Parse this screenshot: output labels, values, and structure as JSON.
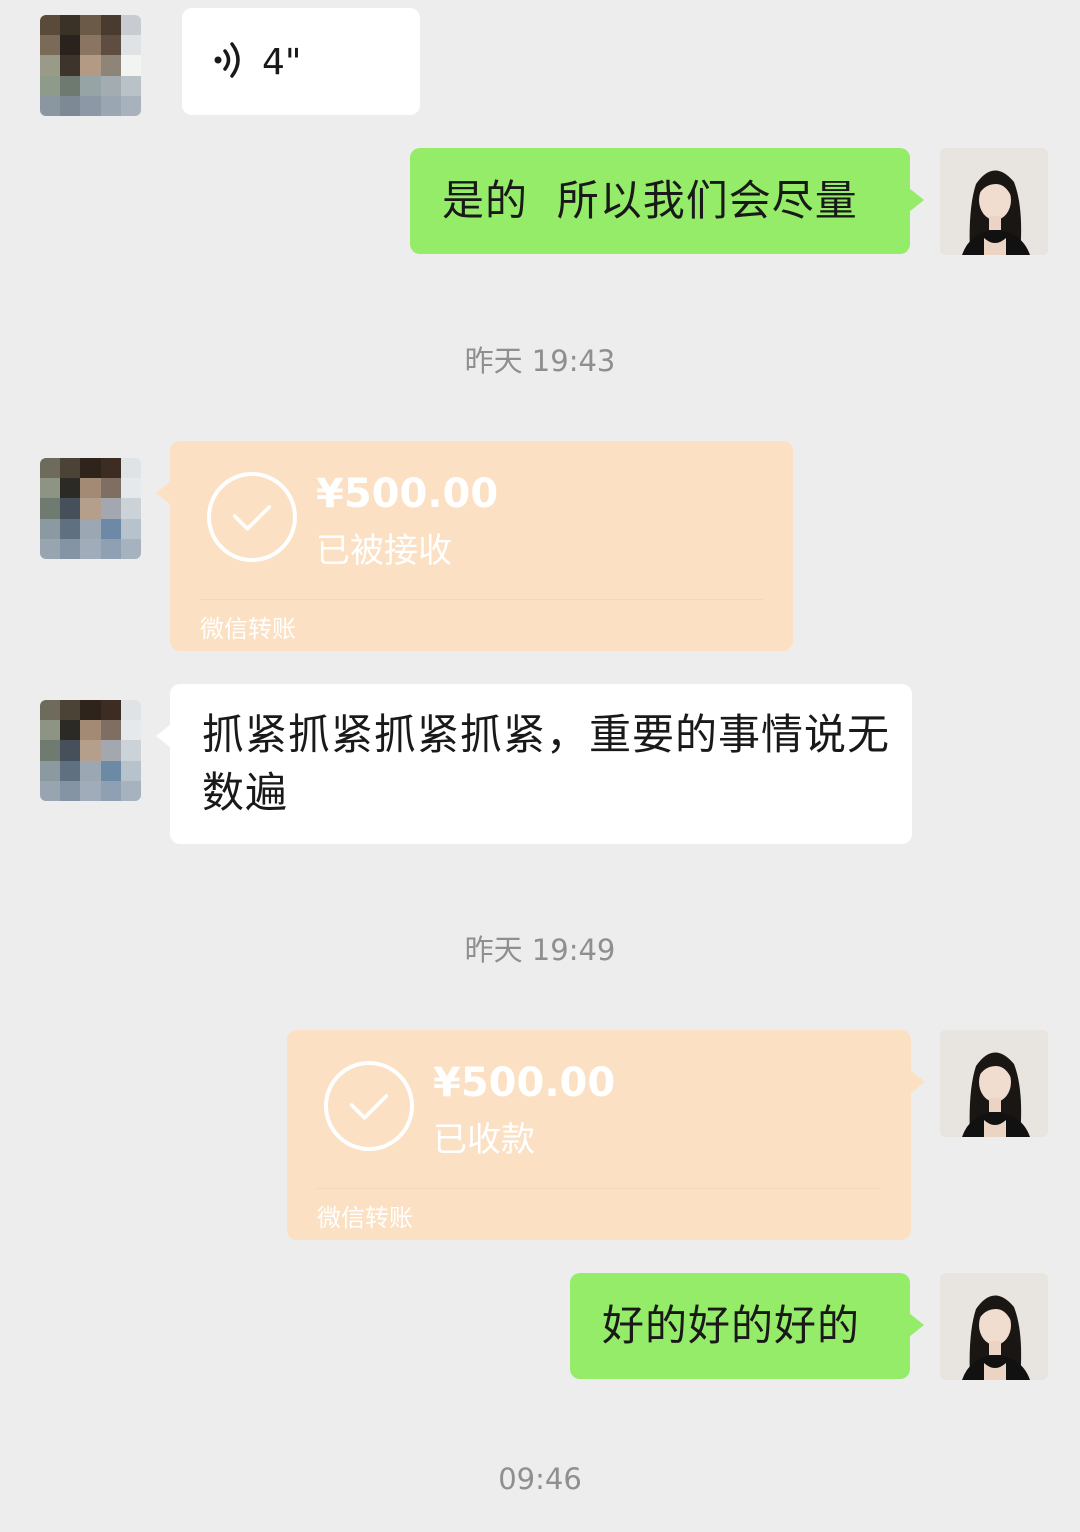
{
  "messages": [
    {
      "type": "voice",
      "sender": "other",
      "duration": "4\""
    },
    {
      "type": "text",
      "sender": "self",
      "text": "是的  所以我们会尽量"
    },
    {
      "type": "timestamp",
      "text": "昨天 19:43"
    },
    {
      "type": "transfer",
      "sender": "other",
      "amount": "¥500.00",
      "status": "已被接收",
      "footer": "微信转账"
    },
    {
      "type": "text",
      "sender": "other",
      "text": "抓紧抓紧抓紧抓紧，重要的事情说无数遍"
    },
    {
      "type": "timestamp",
      "text": "昨天 19:49"
    },
    {
      "type": "transfer",
      "sender": "self",
      "amount": "¥500.00",
      "status": "已收款",
      "footer": "微信转账"
    },
    {
      "type": "text",
      "sender": "self",
      "text": "好的好的好的"
    },
    {
      "type": "timestamp",
      "text": "09:46"
    }
  ],
  "colors": {
    "background": "#ededed",
    "self_bubble": "#95ec69",
    "other_bubble": "#ffffff",
    "transfer_bubble": "#fbe0c3",
    "timestamp_text": "#8f8f8f"
  },
  "icons": {
    "voice": "voice-wave-icon",
    "transfer_received": "check-circle-icon",
    "other_avatar": "pixelated-avatar",
    "self_avatar": "portrait-avatar"
  }
}
